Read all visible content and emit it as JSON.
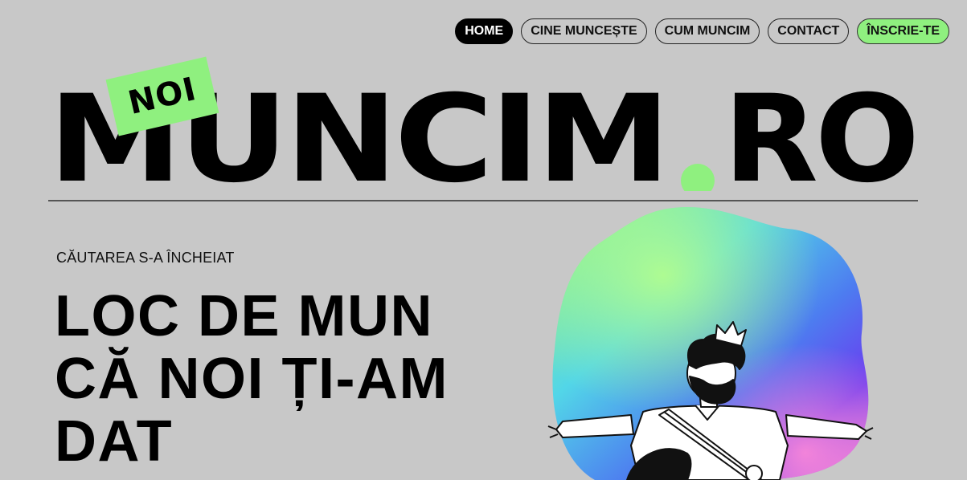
{
  "nav": {
    "items": [
      {
        "label": "HOME",
        "active": true
      },
      {
        "label": "CINE MUNCEȘTE",
        "active": false
      },
      {
        "label": "CUM MUNCIM",
        "active": false
      },
      {
        "label": "CONTACT",
        "active": false
      }
    ],
    "cta_label": "ÎNSCRIE-TE"
  },
  "logo": {
    "tag": "NOI",
    "word": "MUNCIM",
    "dot_color": "#8ff07f",
    "suffix": "RO"
  },
  "hero": {
    "eyebrow": "CĂUTAREA S-A ÎNCHEIAT",
    "headline_lines": [
      "LOC DE MUN",
      "CĂ NOI ȚI-AM",
      "DAT"
    ]
  },
  "colors": {
    "background": "#c8c8c8",
    "accent_green": "#8ff07f",
    "text": "#000000"
  },
  "illustration": {
    "subject": "crowned-man-open-arms",
    "blob_gradient": [
      "#9cf57a",
      "#52d6e8",
      "#4d7cf0",
      "#6a3cf0",
      "#f57fd4"
    ]
  }
}
